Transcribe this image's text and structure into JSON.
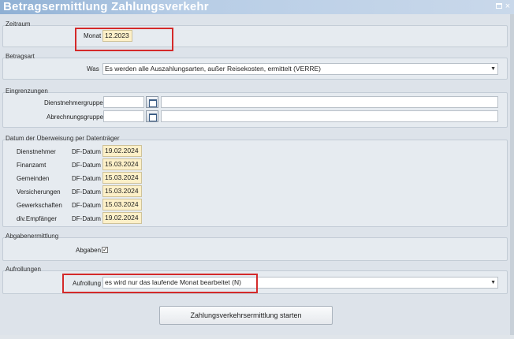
{
  "window": {
    "title": "Betragsermittlung Zahlungsverkehr",
    "close_glyph": "×"
  },
  "zeitraum": {
    "legend": "Zeitraum",
    "monat_label": "Monat",
    "monat_value": "12.2023"
  },
  "betragsart": {
    "legend": "Betragsart",
    "was_label": "Was",
    "was_value": "Es werden alle Auszahlungsarten, außer Reisekosten, ermittelt (VERRE)"
  },
  "eingrenzungen": {
    "legend": "Eingrenzungen",
    "dienstnehmergruppe_label": "Dienstnehmergruppe",
    "abrechnungsgruppe_label": "Abrechnungsgruppe"
  },
  "datum": {
    "legend": "Datum der Überweisung per Datenträger",
    "rows": [
      {
        "name": "Dienstnehmer",
        "type": "DF-Datum",
        "date": "19.02.2024"
      },
      {
        "name": "Finanzamt",
        "type": "DF-Datum",
        "date": "15.03.2024"
      },
      {
        "name": "Gemeinden",
        "type": "DF-Datum",
        "date": "15.03.2024"
      },
      {
        "name": "Versicherungen",
        "type": "DF-Datum",
        "date": "15.03.2024"
      },
      {
        "name": "Gewerkschaften",
        "type": "DF-Datum",
        "date": "15.03.2024"
      },
      {
        "name": "div.Empfänger",
        "type": "DF-Datum",
        "date": "19.02.2024"
      }
    ]
  },
  "abgabenermittlung": {
    "legend": "Abgabenermittlung",
    "abgaben_label": "Abgaben",
    "checked_glyph": "✓"
  },
  "aufrollungen": {
    "legend": "Aufrollungen",
    "aufrollung_label": "Aufrollung",
    "aufrollung_value": "es wird nur das laufende Monat bearbeitet (N)"
  },
  "start_button": {
    "label": "Zahlungsverkehrsermittlung starten"
  },
  "colors": {
    "highlight_field": "#fdf0c8",
    "annotation_box": "#d42a2a",
    "titlebar": "#a9c2de"
  }
}
